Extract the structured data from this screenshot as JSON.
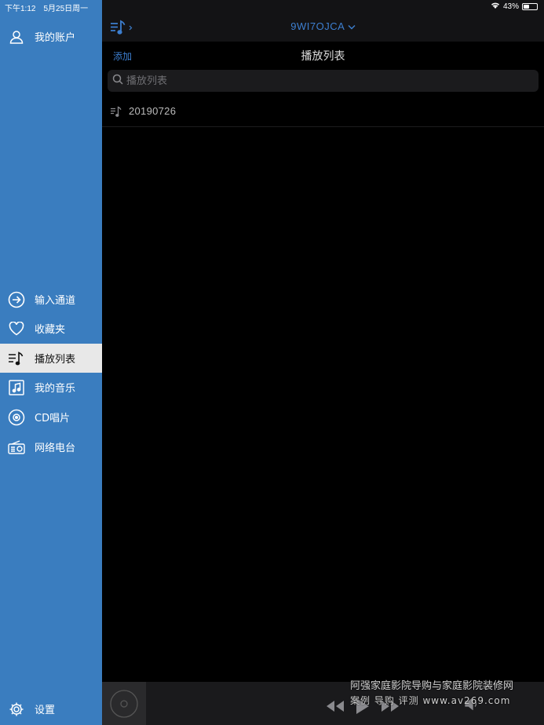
{
  "status": {
    "time": "下午1:12",
    "date": "5月25日周一",
    "battery": "43%",
    "battery_level": 0.43
  },
  "sidebar": {
    "account": "我的账户",
    "items": [
      {
        "label": "输入通道",
        "icon": "arrow-circle-icon"
      },
      {
        "label": "收藏夹",
        "icon": "heart-icon"
      },
      {
        "label": "播放列表",
        "icon": "playlist-icon"
      },
      {
        "label": "我的音乐",
        "icon": "music-note-icon"
      },
      {
        "label": "CD唱片",
        "icon": "disc-icon"
      },
      {
        "label": "网络电台",
        "icon": "radio-icon"
      }
    ],
    "settings": "设置"
  },
  "main": {
    "device": "9WI7OJCA",
    "add_label": "添加",
    "title": "播放列表",
    "search_placeholder": "播放列表",
    "playlists": [
      "20190726"
    ]
  },
  "watermark": {
    "line1": "阿强家庭影院导购与家庭影院装修网",
    "line2": "案例 导购 评测 www.av269.com"
  },
  "colors": {
    "sidebar": "#3a7dbf",
    "accent": "#3d7fd0",
    "background": "#000000"
  }
}
